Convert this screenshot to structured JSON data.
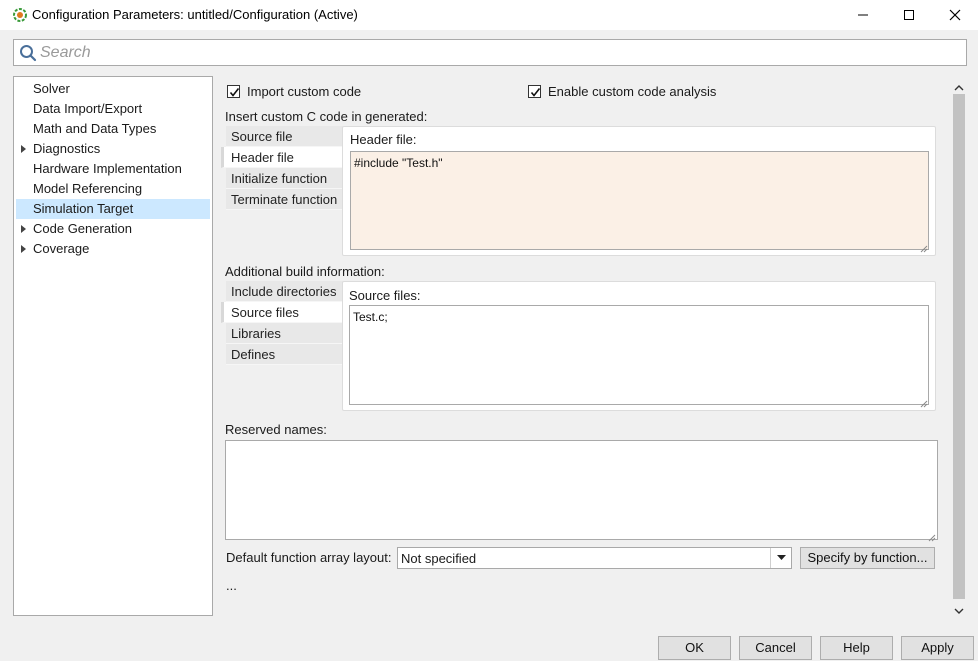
{
  "window": {
    "title": "Configuration Parameters: untitled/Configuration (Active)"
  },
  "search": {
    "placeholder": "Search",
    "value": ""
  },
  "tree": {
    "items": [
      {
        "label": "Solver",
        "expandable": false,
        "selected": false
      },
      {
        "label": "Data Import/Export",
        "expandable": false,
        "selected": false
      },
      {
        "label": "Math and Data Types",
        "expandable": false,
        "selected": false
      },
      {
        "label": "Diagnostics",
        "expandable": true,
        "selected": false
      },
      {
        "label": "Hardware Implementation",
        "expandable": false,
        "selected": false
      },
      {
        "label": "Model Referencing",
        "expandable": false,
        "selected": false
      },
      {
        "label": "Simulation Target",
        "expandable": false,
        "selected": true
      },
      {
        "label": "Code Generation",
        "expandable": true,
        "selected": false
      },
      {
        "label": "Coverage",
        "expandable": true,
        "selected": false
      }
    ]
  },
  "options": {
    "import_custom_code": {
      "label": "Import custom code",
      "checked": true
    },
    "enable_analysis": {
      "label": "Enable custom code analysis",
      "checked": true
    }
  },
  "custom_code": {
    "section_label": "Insert custom C code in generated:",
    "tabs": [
      "Source file",
      "Header file",
      "Initialize function",
      "Terminate function"
    ],
    "active_tab": "Header file",
    "panel_label": "Header file:",
    "value": "#include \"Test.h\""
  },
  "build_info": {
    "section_label": "Additional build information:",
    "tabs": [
      "Include directories",
      "Source files",
      "Libraries",
      "Defines"
    ],
    "active_tab": "Source files",
    "panel_label": "Source files:",
    "value": "Test.c;"
  },
  "reserved": {
    "label": "Reserved names:",
    "value": ""
  },
  "layout": {
    "label": "Default function array layout:",
    "selected": "Not specified",
    "specify_button": "Specify by function..."
  },
  "ellipsis": "...",
  "buttons": {
    "ok": "OK",
    "cancel": "Cancel",
    "help": "Help",
    "apply": "Apply"
  },
  "colors": {
    "selection": "#cce8ff",
    "header_field_bg": "#fbf0e6",
    "accent": "#4a8cd4"
  }
}
